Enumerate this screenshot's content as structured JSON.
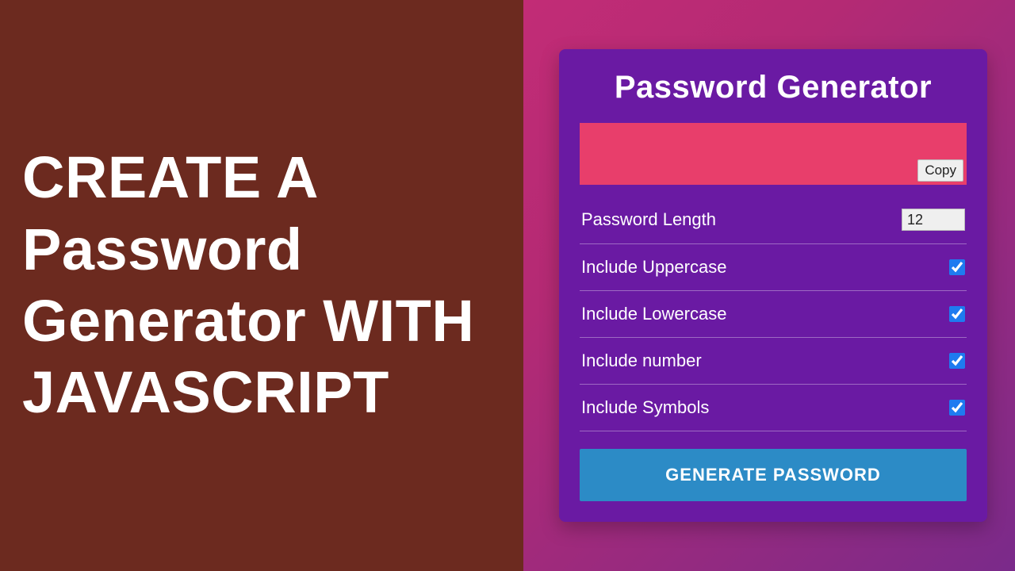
{
  "left": {
    "headline": "CREATE A Password Generator WITH JAVASCRIPT"
  },
  "card": {
    "title": "Password Generator",
    "copy_label": "Copy",
    "rows": {
      "length": {
        "label": "Password Length",
        "value": "12"
      },
      "uppercase": {
        "label": "Include Uppercase",
        "checked": true
      },
      "lowercase": {
        "label": "Include Lowercase",
        "checked": true
      },
      "number": {
        "label": "Include number",
        "checked": true
      },
      "symbols": {
        "label": "Include Symbols",
        "checked": true
      }
    },
    "generate_label": "GENERATE PASSWORD"
  },
  "colors": {
    "left_bg": "#6c2a1f",
    "card_bg": "#6a1aa3",
    "output_bg": "#e83e6b",
    "button_bg": "#2c8bc6",
    "checkbox_accent": "#1e7bf0"
  }
}
